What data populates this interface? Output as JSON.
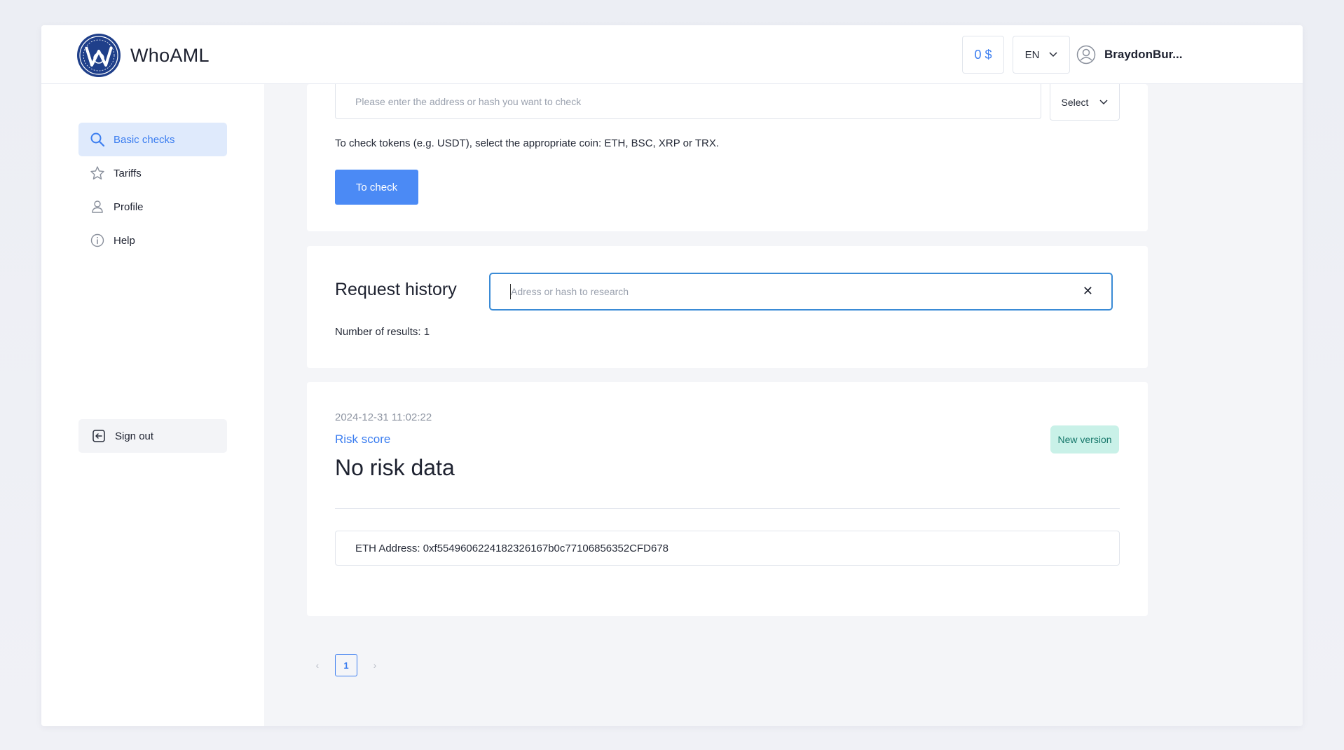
{
  "app": {
    "title": "WhoAML"
  },
  "header": {
    "balance": "0 $",
    "language": "EN",
    "user_name": "BraydonBur..."
  },
  "sidebar": {
    "items": [
      {
        "label": "Basic checks",
        "icon": "search-icon",
        "active": true
      },
      {
        "label": "Tariffs",
        "icon": "star-icon",
        "active": false
      },
      {
        "label": "Profile",
        "icon": "user-icon",
        "active": false
      },
      {
        "label": "Help",
        "icon": "info-icon",
        "active": false
      }
    ],
    "sign_out": "Sign out"
  },
  "check_form": {
    "address_placeholder": "Please enter the address or hash you want to check",
    "select_label": "Select",
    "hint": "To check tokens (e.g. USDT), select the appropriate coin: ETH, BSC, XRP or TRX.",
    "submit_label": "To check"
  },
  "history": {
    "title": "Request history",
    "search_placeholder": "Adress or hash to research",
    "clear_label": "✕",
    "results_text": "Number of results: 1"
  },
  "result": {
    "date": "2024-12-31 11:02:22",
    "risk_label": "Risk score",
    "risk_value": "No risk data",
    "badge": "New version",
    "address": "ETH Address: 0xf5549606224182326167b0c77106856352CFD678"
  },
  "pagination": {
    "prev": "‹",
    "current": "1",
    "next": "›"
  },
  "colors": {
    "accent": "#3c7ef0",
    "button": "#4b8af5",
    "badge_bg": "#c9f1e8",
    "badge_text": "#17786b",
    "search_border": "#3a8bd6"
  }
}
